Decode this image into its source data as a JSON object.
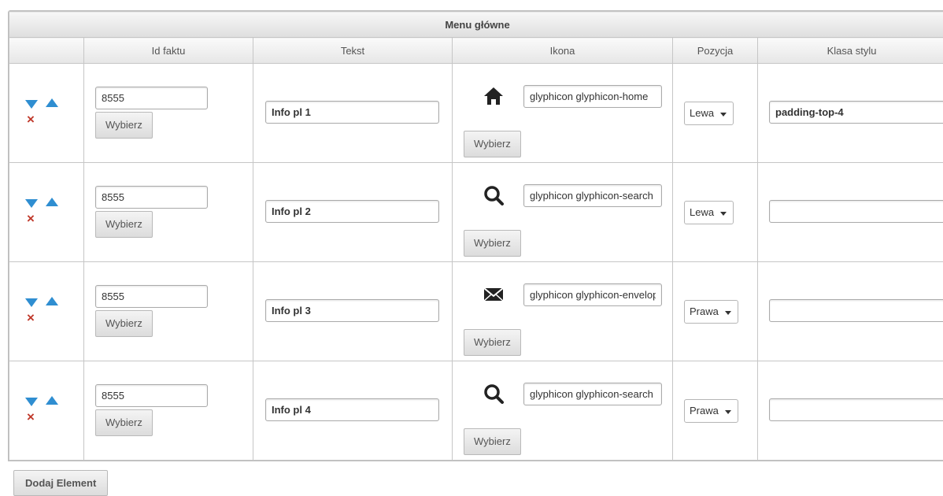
{
  "table": {
    "caption": "Menu główne",
    "headers": [
      "",
      "Id faktu",
      "Tekst",
      "Ikona",
      "Pozycja",
      "Klasa stylu"
    ],
    "choose_label": "Wybierz",
    "rows": [
      {
        "fact_id": "8555",
        "text": "Info pl 1",
        "icon_name": "home-icon",
        "icon_class": "glyphicon glyphicon-home",
        "position": "Lewa",
        "style_class": "padding-top-4"
      },
      {
        "fact_id": "8555",
        "text": "Info pl 2",
        "icon_name": "search-icon",
        "icon_class": "glyphicon glyphicon-search",
        "position": "Lewa",
        "style_class": ""
      },
      {
        "fact_id": "8555",
        "text": "Info pl 3",
        "icon_name": "envelope-icon",
        "icon_class": "glyphicon glyphicon-envelope",
        "position": "Prawa",
        "style_class": ""
      },
      {
        "fact_id": "8555",
        "text": "Info pl 4",
        "icon_name": "search-icon",
        "icon_class": "glyphicon glyphicon-search",
        "position": "Prawa",
        "style_class": ""
      }
    ]
  },
  "add_button_label": "Dodaj Element",
  "colors": {
    "arrow": "#2f8ed1",
    "delete": "#c0392b"
  }
}
